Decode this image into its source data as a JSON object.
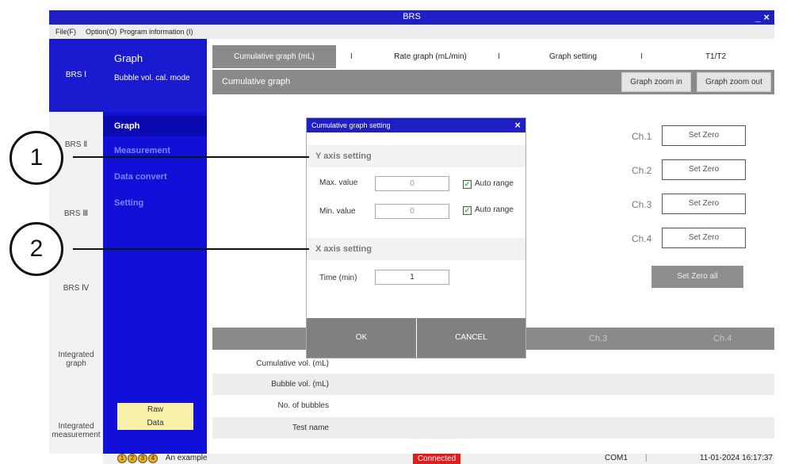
{
  "window": {
    "title": "BRS",
    "controls": "_ ×"
  },
  "menu": {
    "file": "File(F)",
    "option": "Option(O)",
    "program_info": "Program information (I)"
  },
  "left_nav": [
    "BRS Ⅰ",
    "BRS Ⅱ",
    "BRS Ⅲ",
    "BRS Ⅳ",
    "Integrated graph",
    "Integrated measurement"
  ],
  "sub_nav": {
    "title": "Graph",
    "mode": "Bubble vol. cal. mode",
    "items": [
      "Graph",
      "Measurement",
      "Data convert",
      "Setting"
    ],
    "legend": [
      "Raw",
      "Data"
    ]
  },
  "tabs": [
    "Cumulative graph (mL)",
    "Rate graph (mL/min)",
    "Graph setting",
    "T1/T2"
  ],
  "tab_separator": "I",
  "sub_header": {
    "title": "Cumulative graph",
    "zoom_in": "Graph zoom in",
    "zoom_out": "Graph zoom out"
  },
  "channels": {
    "labels": [
      "Ch.1",
      "Ch.2",
      "Ch.3",
      "Ch.4"
    ],
    "set_zero": "Set Zero",
    "set_zero_all": "Set Zero all"
  },
  "table": {
    "headers": [
      "Ch.3",
      "Ch.4"
    ],
    "rows": [
      "Cumulative vol. (mL)",
      "Bubble vol. (mL)",
      "No. of bubbles",
      "Test name"
    ]
  },
  "status_bar": {
    "badges": [
      "1",
      "2",
      "3",
      "4"
    ],
    "example": "An example",
    "connection": "Connected",
    "port": "COM1",
    "separator": "|",
    "datetime": "11-01-2024 16:17:37"
  },
  "dialog": {
    "title": "Cumulative graph setting",
    "close": "×",
    "y_section": "Y axis setting",
    "max_label": "Max. value",
    "max_value": "0",
    "min_label": "Min. value",
    "min_value": "0",
    "auto_range": "Auto range",
    "x_section": "X axis setting",
    "time_label": "Time (min)",
    "time_value": "1",
    "ok": "OK",
    "cancel": "CANCEL"
  },
  "callouts": [
    "1",
    "2"
  ],
  "colors": {
    "title_blue": "#1f1fc8",
    "nav_blue": "#1010d8",
    "connected_red": "#e21b1b",
    "legend_yellow": "#f7f0a8"
  }
}
